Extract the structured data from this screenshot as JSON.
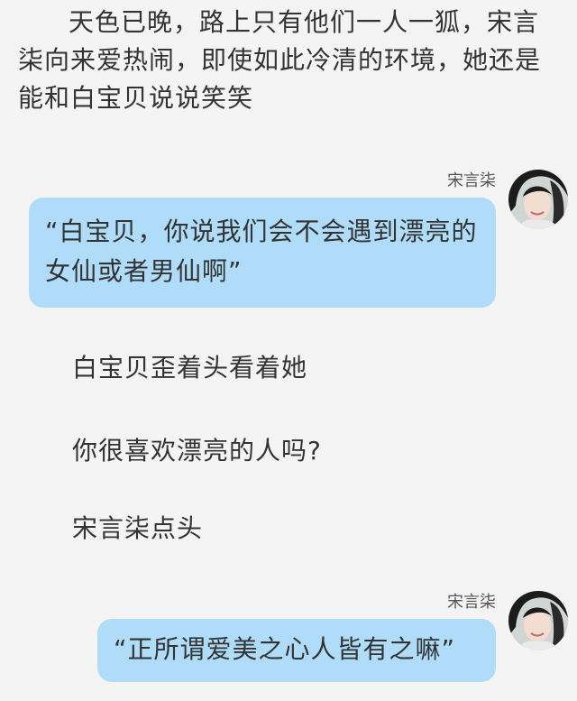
{
  "narration": "天色已晚，路上只有他们一人一狐，宋言柒向来爱热闹，即使如此冷清的环境，她还是能和白宝贝说说笑笑",
  "messages": [
    {
      "sender": "宋言柒",
      "text": "“白宝贝，你说我们会不会遇到漂亮的女仙或者男仙啊”"
    },
    {
      "sender": "宋言柒",
      "text": "“正所谓爱美之心人皆有之嘛”"
    }
  ],
  "lines": [
    "白宝贝歪着头看着她",
    "你很喜欢漂亮的人吗?",
    "宋言柒点头"
  ],
  "colors": {
    "background": "#f4f4f4",
    "bubble": "#aedcf9",
    "text": "#333333"
  }
}
